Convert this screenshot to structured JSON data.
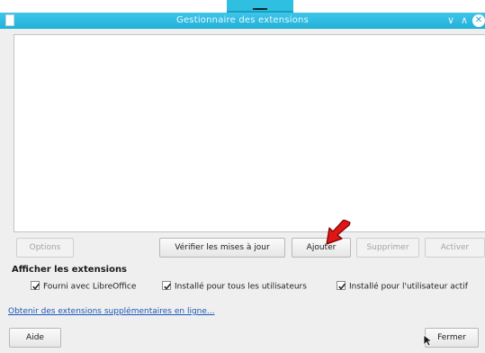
{
  "window": {
    "title": "Gestionnaire des extensions",
    "controls": {
      "minimize": "∨",
      "maximize": "∧",
      "close": "✕"
    }
  },
  "buttons": {
    "options": "Options",
    "check_updates": "Vérifier les mises à jour",
    "add": "Ajouter",
    "remove": "Supprimer",
    "enable": "Activer",
    "help": "Aide",
    "close": "Fermer"
  },
  "filters": {
    "title": "Afficher les extensions",
    "items": [
      {
        "label": "Fourni avec LibreOffice",
        "checked": true
      },
      {
        "label": "Installé pour tous les utilisateurs",
        "checked": true
      },
      {
        "label": "Installé pour l'utilisateur actif",
        "checked": true
      }
    ]
  },
  "link": {
    "text": "Obtenir des extensions supplémentaires en ligne..."
  },
  "colors": {
    "titlebar": "#2fbfe0",
    "annotation_arrow": "#e01616",
    "link": "#1b58b8"
  }
}
